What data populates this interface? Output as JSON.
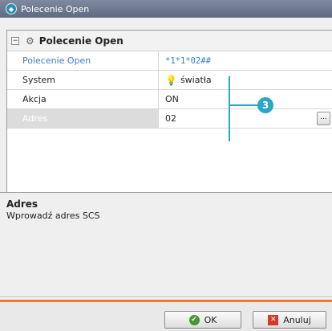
{
  "window": {
    "title": "Polecenie Open",
    "app_icon": "app-logo-icon"
  },
  "grid": {
    "group_title": "Polecenie Open",
    "rows": [
      {
        "label": "Polecenie Open",
        "value": "*1*1*02##"
      },
      {
        "label": "System",
        "value": "światła"
      },
      {
        "label": "Akcja",
        "value": "ON"
      },
      {
        "label": "Adres",
        "value": "02"
      }
    ],
    "ellipsis_label": "..."
  },
  "callout": {
    "number": "3",
    "color": "#2aa6c6"
  },
  "description": {
    "title": "Adres",
    "text": "Wprowadź adres SCS"
  },
  "footer": {
    "ok_label": "OK",
    "cancel_label": "Anuluj"
  },
  "colors": {
    "accent_orange": "#f07a2e",
    "link_blue": "#3d7fc2"
  }
}
